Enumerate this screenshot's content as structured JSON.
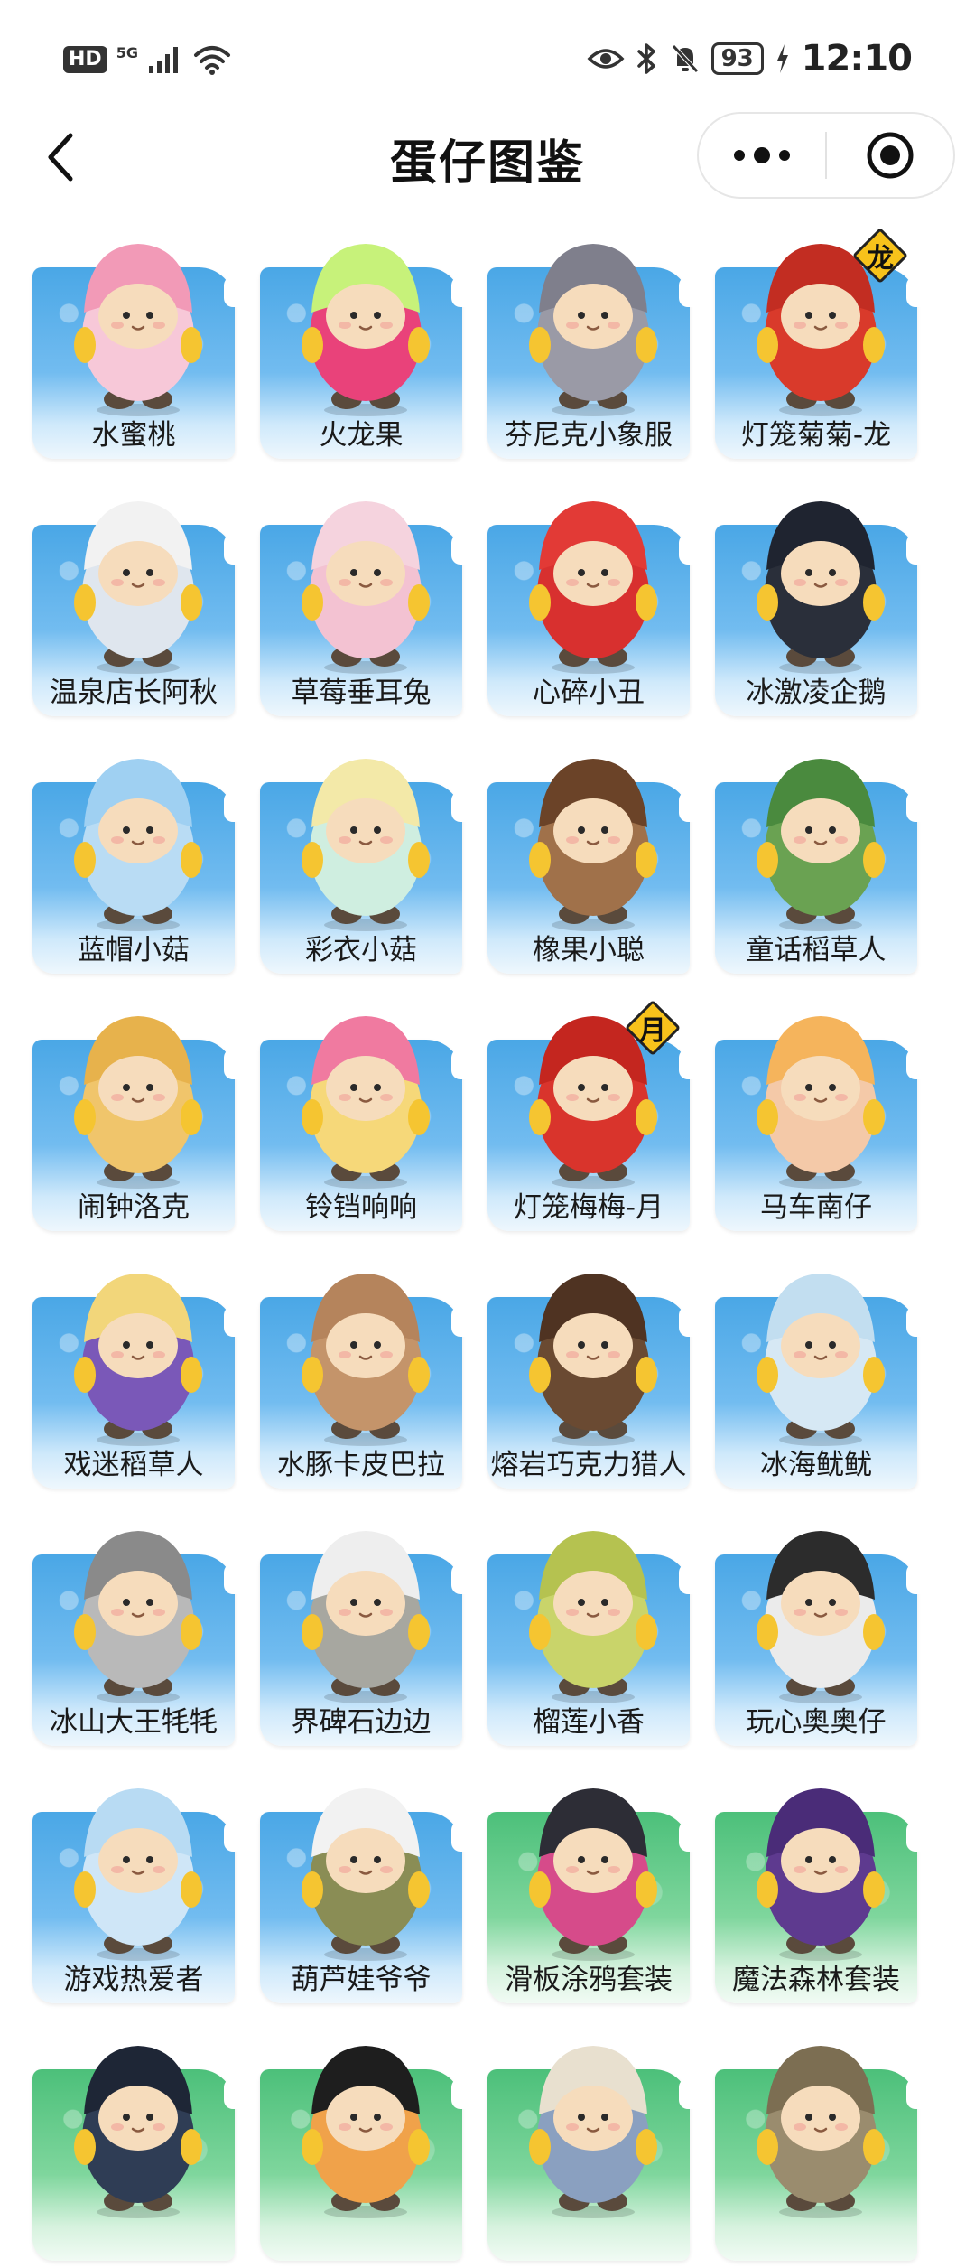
{
  "status_bar": {
    "left_badge": "HD",
    "network": "5G",
    "battery": "93",
    "time": "12:10",
    "icons": [
      "signal-icon",
      "wifi-icon",
      "eye-icon",
      "bluetooth-icon",
      "mute-icon",
      "charging-icon"
    ]
  },
  "nav": {
    "title": "蛋仔图鉴",
    "back_icon": "chevron-left-icon",
    "more_icon": "more-dots-icon",
    "close_icon": "target-close-icon"
  },
  "colors": {
    "card_blue": "#4aa7e6",
    "card_green": "#4cc07a",
    "badge_yellow": "#f7c21b"
  },
  "items": [
    {
      "label": "水蜜桃",
      "bg": "blue",
      "body": "#f7c8d8",
      "hat": "#f29ab7"
    },
    {
      "label": "火龙果",
      "bg": "blue",
      "body": "#e9427a",
      "hat": "#c7f27a"
    },
    {
      "label": "芬尼克小象服",
      "bg": "blue",
      "body": "#9a9aa6",
      "hat": "#7f7f8c"
    },
    {
      "label": "灯笼菊菊-龙",
      "bg": "blue",
      "body": "#d93a2b",
      "hat": "#c22d22",
      "badge": "龙"
    },
    {
      "label": "温泉店长阿秋",
      "bg": "blue",
      "body": "#dfe6ee",
      "hat": "#f2f2f2"
    },
    {
      "label": "草莓垂耳兔",
      "bg": "blue",
      "body": "#f3c2d2",
      "hat": "#f5d3de"
    },
    {
      "label": "心碎小丑",
      "bg": "blue",
      "body": "#d8302f",
      "hat": "#e23a36"
    },
    {
      "label": "冰激凌企鹅",
      "bg": "blue",
      "body": "#2a2f3a",
      "hat": "#1f2430"
    },
    {
      "label": "蓝帽小菇",
      "bg": "blue",
      "body": "#b9dcf4",
      "hat": "#9fd0f2"
    },
    {
      "label": "彩衣小菇",
      "bg": "blue",
      "body": "#cfeee0",
      "hat": "#f3e9a8"
    },
    {
      "label": "橡果小聪",
      "bg": "blue",
      "body": "#a0714a",
      "hat": "#6b4328"
    },
    {
      "label": "童话稻草人",
      "bg": "blue",
      "body": "#6aa252",
      "hat": "#4a8a3e"
    },
    {
      "label": "闹钟洛克",
      "bg": "blue",
      "body": "#f0c56b",
      "hat": "#e7b24c"
    },
    {
      "label": "铃铛响响",
      "bg": "blue",
      "body": "#f6d879",
      "hat": "#f07aa0"
    },
    {
      "label": "灯笼梅梅-月",
      "bg": "blue",
      "body": "#d9342c",
      "hat": "#c4261f",
      "badge": "月"
    },
    {
      "label": "马车南仔",
      "bg": "blue",
      "body": "#f4c9a8",
      "hat": "#f5b45c"
    },
    {
      "label": "戏迷稻草人",
      "bg": "blue",
      "body": "#7a58b8",
      "hat": "#f2d67a"
    },
    {
      "label": "水豚卡皮巴拉",
      "bg": "blue",
      "body": "#c4946a",
      "hat": "#b5845c"
    },
    {
      "label": "熔岩巧克力猎人",
      "bg": "blue",
      "body": "#6a4a32",
      "hat": "#4f3322"
    },
    {
      "label": "冰海鱿鱿",
      "bg": "blue",
      "body": "#d6e8f4",
      "hat": "#c2def0"
    },
    {
      "label": "冰山大王牦牦",
      "bg": "blue",
      "body": "#b9b9b9",
      "hat": "#8a8a8a"
    },
    {
      "label": "界碑石边边",
      "bg": "blue",
      "body": "#a7a7a0",
      "hat": "#eeeeee"
    },
    {
      "label": "榴莲小香",
      "bg": "blue",
      "body": "#c9d46a",
      "hat": "#b5c250"
    },
    {
      "label": "玩心奥奥仔",
      "bg": "blue",
      "body": "#ebebeb",
      "hat": "#2c2c2c"
    },
    {
      "label": "游戏热爱者",
      "bg": "blue",
      "body": "#cfe6f7",
      "hat": "#b8dbf3"
    },
    {
      "label": "葫芦娃爷爷",
      "bg": "blue",
      "body": "#8a8d55",
      "hat": "#f2f2f2"
    },
    {
      "label": "滑板涂鸦套装",
      "bg": "green",
      "body": "#d64b8a",
      "hat": "#2d2d36"
    },
    {
      "label": "魔法森林套装",
      "bg": "green",
      "body": "#5e3a8f",
      "hat": "#4a2c78"
    },
    {
      "label": "",
      "bg": "green",
      "body": "#2f3d55",
      "hat": "#1e2636"
    },
    {
      "label": "",
      "bg": "green",
      "body": "#f0a24a",
      "hat": "#1e1e1e"
    },
    {
      "label": "",
      "bg": "green",
      "body": "#8aa0c0",
      "hat": "#e8e0cf"
    },
    {
      "label": "",
      "bg": "green",
      "body": "#9a8c6e",
      "hat": "#7c6e52"
    }
  ]
}
